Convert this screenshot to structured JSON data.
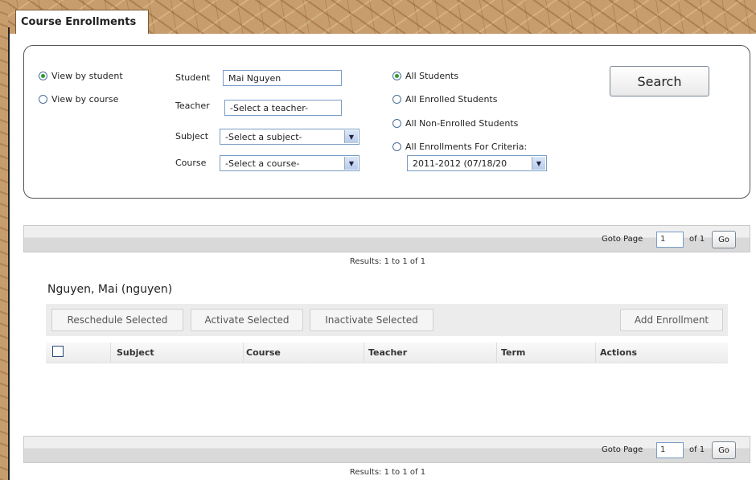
{
  "tab": {
    "title": "Course Enrollments"
  },
  "filters": {
    "view_by_student": "View by student",
    "view_by_course": "View by course",
    "student_label": "Student",
    "student_value": "Mai Nguyen",
    "teacher_label": "Teacher",
    "teacher_value": "-Select a teacher-",
    "subject_label": "Subject",
    "subject_value": "-Select a subject-",
    "course_label": "Course",
    "course_value": "-Select a course-",
    "all_students": "All Students",
    "all_enrolled": "All Enrolled Students",
    "all_non_enrolled": "All Non-Enrolled Students",
    "all_enrollments_criteria": "All Enrollments For Criteria:",
    "term_value": "2011-2012 (07/18/20",
    "search_button": "Search"
  },
  "pager": {
    "goto_label": "Goto Page",
    "page_value": "1",
    "of_text": "of 1",
    "go_button": "Go",
    "results_text": "Results: 1 to 1 of 1"
  },
  "student": {
    "name": "Nguyen, Mai (nguyen)"
  },
  "actions": {
    "reschedule": "Reschedule Selected",
    "activate": "Activate Selected",
    "inactivate": "Inactivate Selected",
    "add_enrollment": "Add Enrollment"
  },
  "table": {
    "columns": [
      "Subject",
      "Course",
      "Teacher",
      "Term",
      "Actions"
    ]
  }
}
